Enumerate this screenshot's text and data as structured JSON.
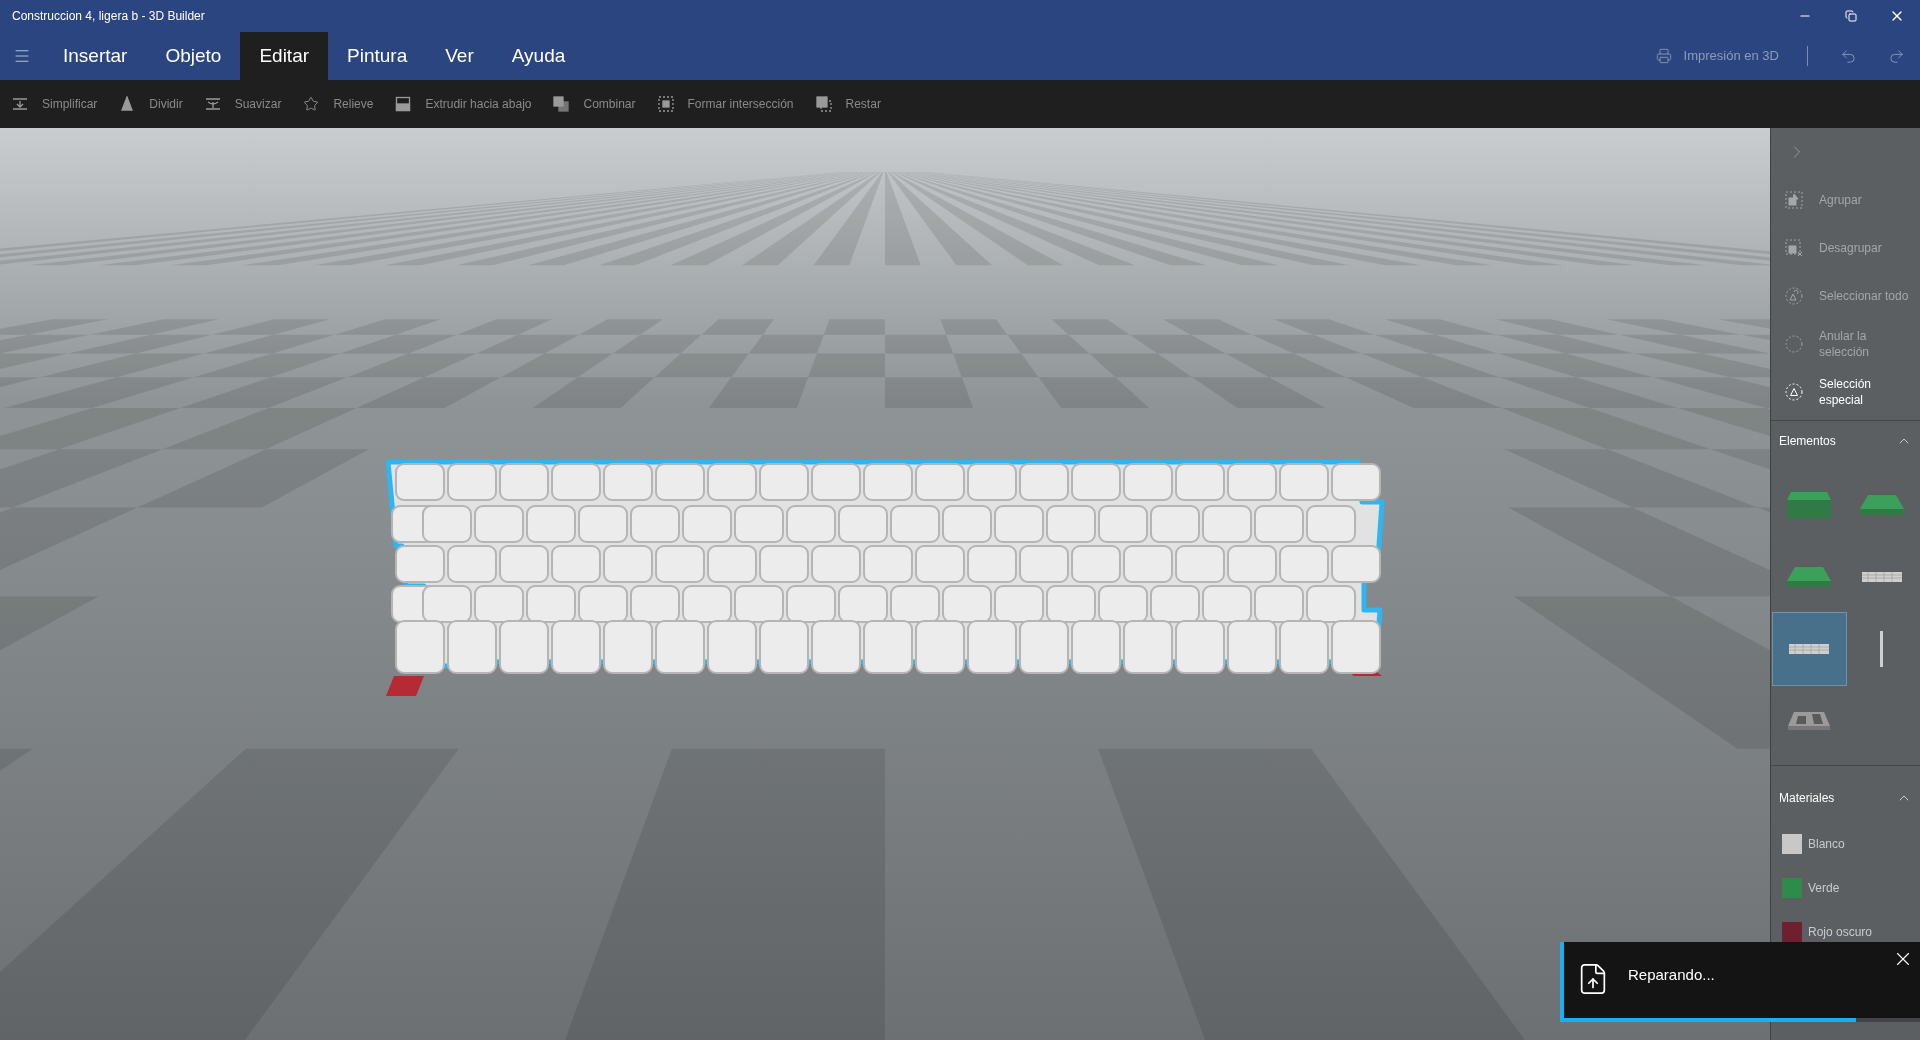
{
  "window": {
    "title": "Construccion 4, ligera b - 3D Builder"
  },
  "menu_tabs": [
    {
      "label": "Insertar",
      "selected": false
    },
    {
      "label": "Objeto",
      "selected": false
    },
    {
      "label": "Editar",
      "selected": true
    },
    {
      "label": "Pintura",
      "selected": false
    },
    {
      "label": "Ver",
      "selected": false
    },
    {
      "label": "Ayuda",
      "selected": false
    }
  ],
  "print_button": {
    "label": "Impresión en 3D",
    "disabled": true
  },
  "toolbar": [
    {
      "label": "Simplificar",
      "kind": "simplify",
      "disabled": true
    },
    {
      "label": "Dividir",
      "kind": "split",
      "disabled": true
    },
    {
      "label": "Suavizar",
      "kind": "smooth",
      "disabled": true
    },
    {
      "label": "Relieve",
      "kind": "emboss",
      "disabled": true
    },
    {
      "label": "Extrudir hacia abajo",
      "kind": "extrude",
      "disabled": true
    },
    {
      "label": "Combinar",
      "kind": "merge",
      "disabled": true
    },
    {
      "label": "Formar intersección",
      "kind": "intersect",
      "disabled": true
    },
    {
      "label": "Restar",
      "kind": "subtract",
      "disabled": true
    }
  ],
  "side_panel": {
    "actions": [
      {
        "label": "Agrupar",
        "kind": "group",
        "disabled": true
      },
      {
        "label": "Desagrupar",
        "kind": "ungroup",
        "disabled": true
      },
      {
        "label": "Seleccionar todo",
        "kind": "select_all",
        "disabled": true
      },
      {
        "label": "Anular la selección",
        "kind": "deselect",
        "disabled": true
      },
      {
        "label": "Selección especial",
        "kind": "special",
        "disabled": false
      }
    ],
    "elements": {
      "title": "Elementos",
      "expanded": true,
      "items": [
        {
          "kind": "box",
          "selected": false
        },
        {
          "kind": "slab",
          "selected": false
        },
        {
          "kind": "slab",
          "selected": false
        },
        {
          "kind": "wall",
          "selected": false
        },
        {
          "kind": "wall",
          "selected": true
        },
        {
          "kind": "post",
          "selected": false
        },
        {
          "kind": "tray",
          "selected": false
        }
      ]
    },
    "materials": {
      "title": "Materiales",
      "expanded": true,
      "items": [
        {
          "label": "Blanco",
          "color": "#c8c8c8"
        },
        {
          "label": "Verde",
          "color": "#2e8b4a"
        },
        {
          "label": "Rojo oscuro",
          "color": "#6e2030"
        }
      ]
    }
  },
  "notification": {
    "text": "Reparando...",
    "level": 0.82
  }
}
